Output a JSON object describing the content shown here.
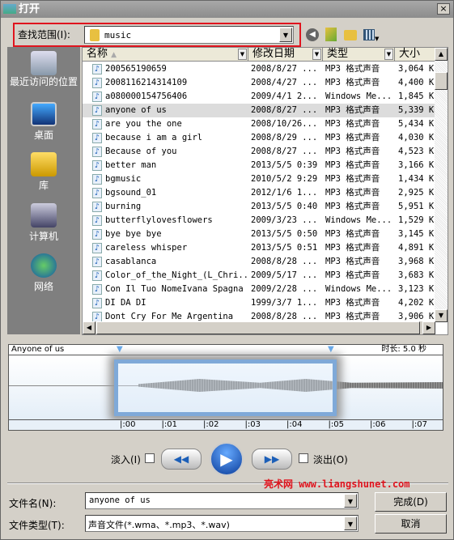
{
  "window": {
    "title": "打开",
    "close": "×"
  },
  "lookin": {
    "label": "查找范围(I):",
    "value": "music"
  },
  "toolbar": {
    "icons": [
      "back-icon",
      "up-folder-icon",
      "new-folder-icon",
      "view-menu-icon"
    ]
  },
  "sidebar": {
    "items": [
      {
        "label": "最近访问的位置",
        "icon": "recent-places-icon"
      },
      {
        "label": "桌面",
        "icon": "desktop-icon"
      },
      {
        "label": "库",
        "icon": "library-icon"
      },
      {
        "label": "计算机",
        "icon": "computer-icon"
      },
      {
        "label": "网络",
        "icon": "network-icon"
      }
    ]
  },
  "columns": [
    "名称",
    "修改日期",
    "类型",
    "大小"
  ],
  "files": [
    [
      "200565190659",
      "2008/8/27 ...",
      "MP3 格式声音",
      "3,064 K"
    ],
    [
      "2008116214314109",
      "2008/4/27 ...",
      "MP3 格式声音",
      "4,400 K"
    ],
    [
      "a080000154756406",
      "2009/4/1 2...",
      "Windows Me...",
      "1,845 K"
    ],
    [
      "anyone of us",
      "2008/8/27 ...",
      "MP3 格式声音",
      "5,339 K"
    ],
    [
      "are you the one",
      "2008/10/26...",
      "MP3 格式声音",
      "5,434 K"
    ],
    [
      "because i am a girl",
      "2008/8/29 ...",
      "MP3 格式声音",
      "4,030 K"
    ],
    [
      "Because of you",
      "2008/8/27 ...",
      "MP3 格式声音",
      "4,523 K"
    ],
    [
      "better man",
      "2013/5/5 0:39",
      "MP3 格式声音",
      "3,166 K"
    ],
    [
      "bgmusic",
      "2010/5/2 9:29",
      "MP3 格式声音",
      "1,434 K"
    ],
    [
      "bgsound_01",
      "2012/1/6 1...",
      "MP3 格式声音",
      "2,925 K"
    ],
    [
      "burning",
      "2013/5/5 0:40",
      "MP3 格式声音",
      "5,951 K"
    ],
    [
      "butterflylovesflowers",
      "2009/3/23 ...",
      "Windows Me...",
      "1,529 K"
    ],
    [
      "bye bye bye",
      "2013/5/5 0:50",
      "MP3 格式声音",
      "3,145 K"
    ],
    [
      "careless whisper",
      "2013/5/5 0:51",
      "MP3 格式声音",
      "4,891 K"
    ],
    [
      "casablanca",
      "2008/8/28 ...",
      "MP3 格式声音",
      "3,968 K"
    ],
    [
      "Color_of_the_Night_(L_Chri...",
      "2009/5/17 ...",
      "MP3 格式声音",
      "3,683 K"
    ],
    [
      "Con Il Tuo NomeIvana Spagna",
      "2009/2/28 ...",
      "Windows Me...",
      "3,123 K"
    ],
    [
      "DI DA DI",
      "1999/3/7 1...",
      "MP3 格式声音",
      "4,202 K"
    ],
    [
      "Dont Cry For Me Argentina",
      "2008/8/28 ...",
      "MP3 格式声音",
      "3,906 K"
    ]
  ],
  "selected_index": 3,
  "preview": {
    "track": "Anyone of us",
    "duration": "时长: 5.0 秒",
    "ticks": [
      ":00",
      ":01",
      ":02",
      ":03",
      ":04",
      ":05",
      ":06",
      ":07"
    ]
  },
  "controls": {
    "fade_in": "淡入(I)",
    "fade_out": "淡出(O)",
    "fade_in_checked": false,
    "fade_out_checked": false
  },
  "watermark": "亮术网 www.liangshunet.com",
  "filename": {
    "label": "文件名(N):",
    "value": "anyone of us"
  },
  "filetype": {
    "label": "文件类型(T):",
    "value": "声音文件(*.wma、*.mp3、*.wav)"
  },
  "buttons": {
    "ok": "完成(D)",
    "cancel": "取消"
  },
  "colors": {
    "highlight": "#e0141e",
    "accent": "#1c5fb8"
  }
}
